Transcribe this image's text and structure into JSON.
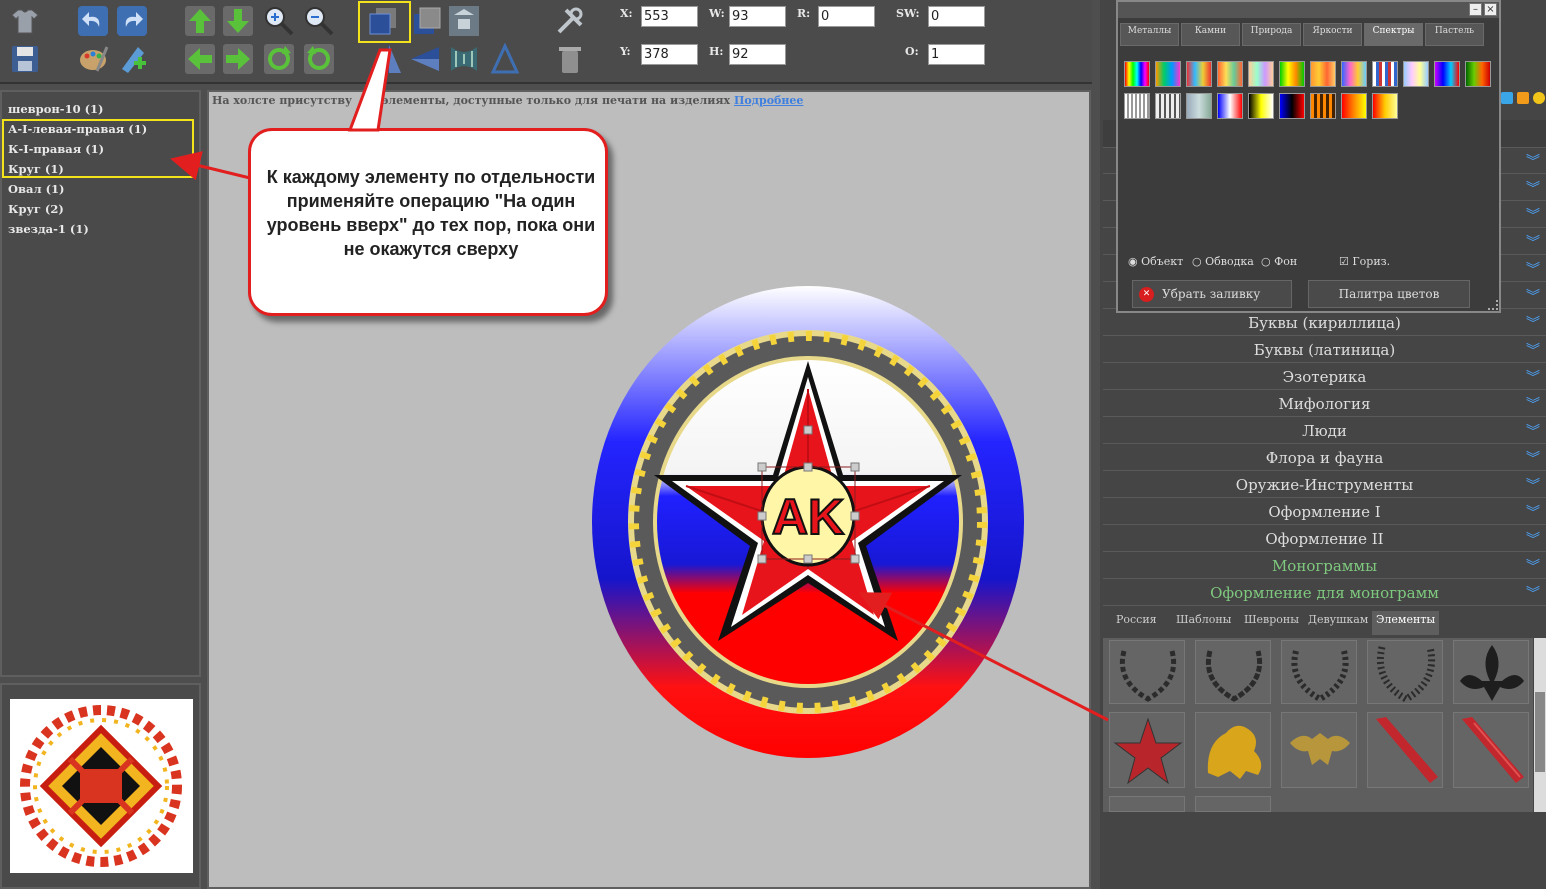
{
  "toolbar": {
    "icons": [
      "tshirt-icon",
      "undo-icon",
      "redo-icon",
      "move-up-icon",
      "move-down-icon",
      "zoom-in-icon",
      "zoom-out-icon",
      "layer-up-icon",
      "layer-down-icon",
      "align-icon",
      "tools-icon",
      "save-icon",
      "palette-icon",
      "add-image-icon",
      "move-left-icon",
      "move-right-icon",
      "rotate-cw-icon",
      "rotate-ccw-icon",
      "flip-v-icon",
      "flip-h-icon",
      "warp-icon",
      "skew-icon",
      "delete-icon"
    ],
    "props": {
      "x": {
        "label": "X:",
        "value": "553"
      },
      "w": {
        "label": "W:",
        "value": "93"
      },
      "r": {
        "label": "R:",
        "value": "0"
      },
      "sw": {
        "label": "SW:",
        "value": "0"
      },
      "y": {
        "label": "Y:",
        "value": "378"
      },
      "h": {
        "label": "H:",
        "value": "92"
      },
      "o": {
        "label": "O:",
        "value": "1"
      }
    }
  },
  "layers": [
    "шеврон-10 (1)",
    "А-I-левая-правая (1)",
    "К-I-правая (1)",
    "Круг (1)",
    "Овал (1)",
    "Круг (2)",
    "звезда-1 (1)"
  ],
  "canvas": {
    "notice": "На холсте присутству",
    "notice2": "элементы, доступные только для печати на изделиях",
    "notice_link": "Подробнее",
    "monogram": "AK"
  },
  "callout": {
    "text": "К каждому элементу по отдельности применяйте операцию \"На один уровень вверх\" до тех пор, пока они не окажутся сверху"
  },
  "palette": {
    "tabs": [
      "Металлы",
      "Камни",
      "Природа",
      "Яркости",
      "Спектры",
      "Пастель"
    ],
    "active_tab": "Спектры",
    "fill_target": {
      "object": "Объект",
      "stroke": "Обводка",
      "background": "Фон"
    },
    "horizontal": "Гориз.",
    "remove_fill": "Убрать заливку",
    "color_palette": "Палитра цветов"
  },
  "categories": [
    "Буквы (кириллица)",
    "Буквы (латиница)",
    "Эзотерика",
    "Мифология",
    "Люди",
    "Флора и фауна",
    "Оружие-Инструменты",
    "Оформление I",
    "Оформление II",
    "Монограммы",
    "Оформление для монограмм"
  ],
  "bottom_tabs": [
    "Россия",
    "Шаблоны",
    "Шевроны",
    "Девушкам",
    "Элементы"
  ],
  "active_bottom_tab": "Элементы",
  "colors": {
    "accent": "#f3e31a",
    "callout_border": "#e21e1e",
    "link": "#3e7fe0",
    "category_green": "#7fc97f"
  }
}
